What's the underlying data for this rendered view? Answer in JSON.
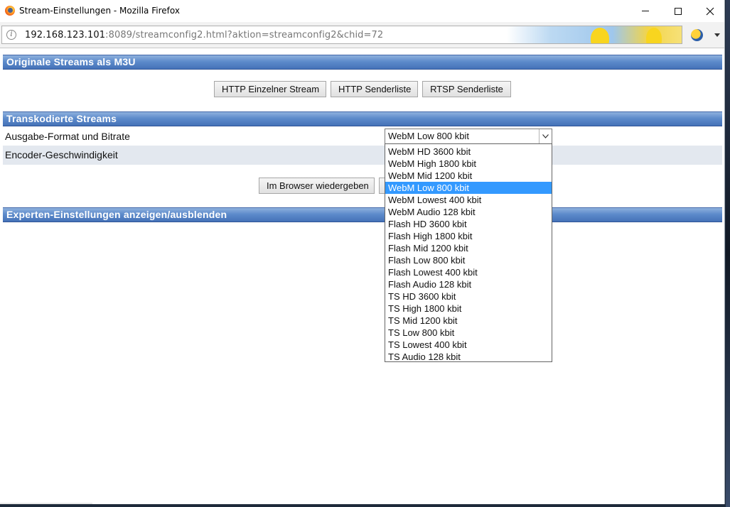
{
  "window": {
    "title": "Stream-Einstellungen - Mozilla Firefox",
    "url_host": "192.168.123.101",
    "url_rest": ":8089/streamconfig2.html?aktion=streamconfig2&chid=72"
  },
  "sections": {
    "original": {
      "header": "Originale Streams als M3U",
      "buttons": [
        "HTTP Einzelner Stream",
        "HTTP Senderliste",
        "RTSP Senderliste"
      ]
    },
    "transcoded": {
      "header": "Transkodierte Streams",
      "format_label": "Ausgabe-Format und Bitrate",
      "encoder_label": "Encoder-Geschwindigkeit",
      "play_button": "Im Browser wiedergeben"
    },
    "expert": {
      "header": "Experten-Einstellungen anzeigen/ausblenden"
    }
  },
  "format_select": {
    "selected": "WebM Low 800 kbit",
    "options": [
      "WebM HD 3600 kbit",
      "WebM High 1800 kbit",
      "WebM Mid 1200 kbit",
      "WebM Low 800 kbit",
      "WebM Lowest 400 kbit",
      "WebM Audio 128 kbit",
      "Flash HD 3600 kbit",
      "Flash High 1800 kbit",
      "Flash Mid 1200 kbit",
      "Flash Low 800 kbit",
      "Flash Lowest 400 kbit",
      "Flash Audio 128 kbit",
      "TS HD 3600 kbit",
      "TS High 1800 kbit",
      "TS Mid 1200 kbit",
      "TS Low 800 kbit",
      "TS Lowest 400 kbit",
      "TS Audio 128 kbit"
    ],
    "highlighted_index": 3
  },
  "colors": {
    "section_header": "#4572b8",
    "highlight": "#3399ff",
    "encoder_row": "#e3e8ef"
  },
  "icons": [
    "firefox-logo-icon",
    "info-icon",
    "minimize-icon",
    "maximize-icon",
    "close-icon",
    "chevron-down-icon",
    "extension-icon"
  ]
}
